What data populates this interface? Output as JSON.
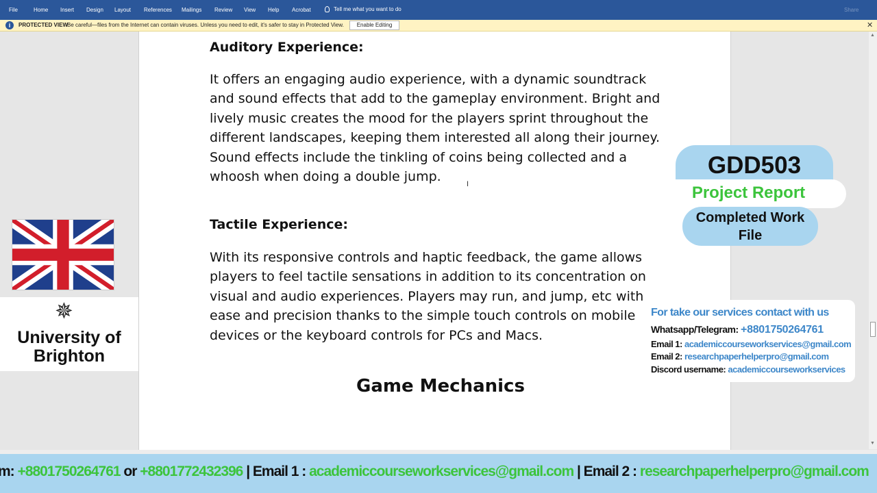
{
  "menubar": {
    "items": [
      "File",
      "Home",
      "Insert",
      "Design",
      "Layout",
      "References",
      "Mailings",
      "Review",
      "View",
      "Help",
      "Acrobat"
    ],
    "tell_me": "Tell me what you want to do",
    "share": "Share"
  },
  "protected_view": {
    "title": "PROTECTED VIEW",
    "message": "Be careful—files from the Internet can contain viruses. Unless you need to edit, it's safer to stay in Protected View.",
    "button": "Enable Editing"
  },
  "document": {
    "auditory_heading": "Auditory Experience:",
    "auditory_text": "It  offers an engaging audio experience, with a dynamic soundtrack and sound effects that add to the gameplay environment. Bright and lively music creates the mood for the players sprint throughout the different landscapes, keeping them interested all along their journey. Sound effects include the tinkling of coins being collected and a whoosh when doing a double jump.",
    "tactile_heading": "Tactile Experience:",
    "tactile_text": "With its responsive controls and haptic feedback, the game allows players to feel tactile sensations in addition to its concentration on visual and audio experiences. Players may run, and jump, etc with ease and precision thanks to the simple touch controls on mobile devices or the keyboard controls for PCs and Macs.",
    "section_heading": "Game Mechanics"
  },
  "overlay": {
    "university": "University of Brighton",
    "course_code": "GDD503",
    "project_report": "Project Report",
    "completed": "Completed Work File",
    "contact_title": "For take our services contact with us",
    "contacts": [
      {
        "label": "Whatsapp/Telegram: ",
        "value": "+8801750264761"
      },
      {
        "label": "Email 1: ",
        "value": "academiccourseworkservices@gmail.com"
      },
      {
        "label": "Email 2: ",
        "value": "researchpaperhelperpro@gmail.com"
      },
      {
        "label": "Discord username: ",
        "value": "academiccourseworkservices"
      }
    ],
    "ticker": [
      "m: ",
      "+8801750264761",
      " or ",
      "+8801772432396",
      " | Email 1 : ",
      "academiccourseworkservices@gmail.com",
      " | Email 2 : ",
      "researchpaperhelperpro@gmail.com"
    ]
  },
  "colors": {
    "ribbon": "#2b579a",
    "protected_bar": "#fff3c3",
    "accent_blue": "#3d87c9",
    "accent_green": "#3cc43c",
    "badge_bg": "#a9d5ef"
  }
}
